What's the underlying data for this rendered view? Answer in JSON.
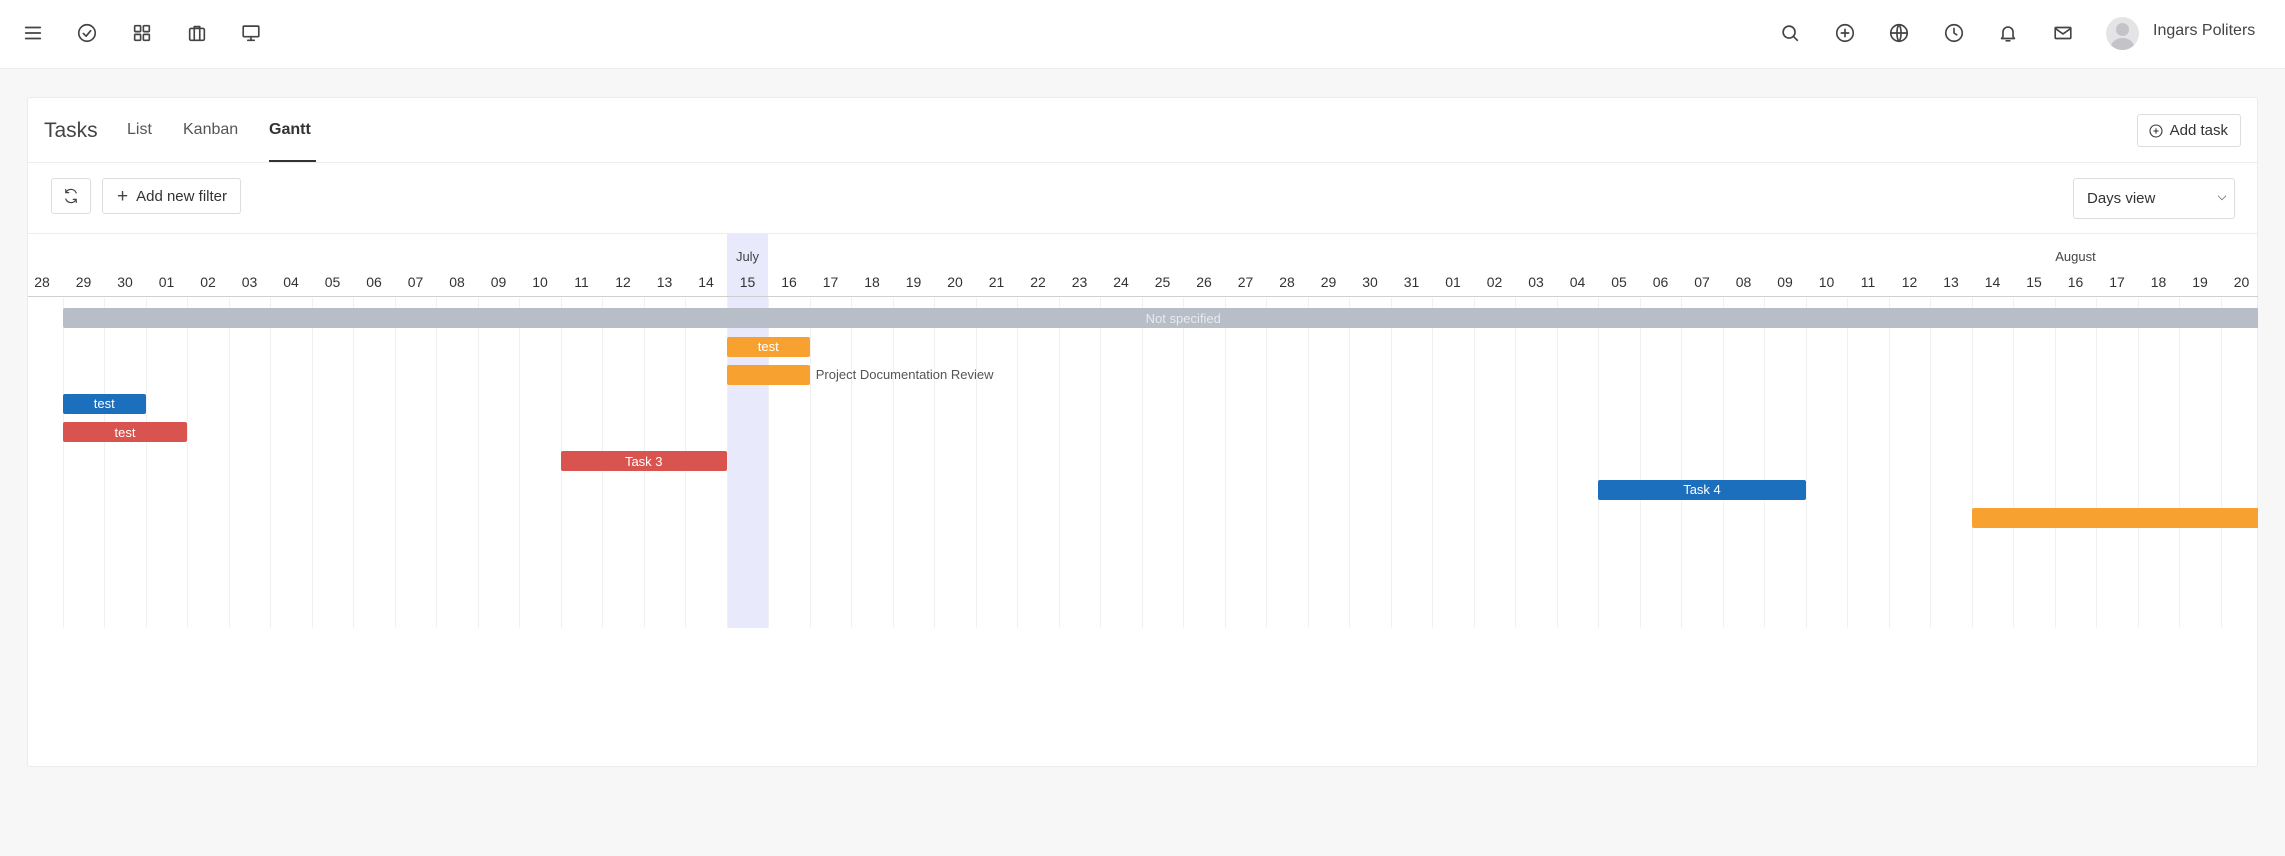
{
  "topbar": {
    "left_icons": [
      "menu-icon",
      "tasks-check-icon",
      "apps-grid-icon",
      "briefcase-icon",
      "monitor-icon"
    ],
    "right_icons": [
      "search-icon",
      "add-circle-icon",
      "globe-icon",
      "clock-icon",
      "bell-icon",
      "mail-icon"
    ],
    "user_name": "Ingars Politers"
  },
  "header": {
    "title": "Tasks",
    "tabs": [
      {
        "label": "List",
        "active": false
      },
      {
        "label": "Kanban",
        "active": false
      },
      {
        "label": "Gantt",
        "active": true
      }
    ],
    "add_task_label": "Add task"
  },
  "toolbar": {
    "add_filter_label": "Add new filter",
    "view_select_value": "Days view"
  },
  "gantt": {
    "months": [
      {
        "label": "July",
        "day_index": 17
      },
      {
        "label": "August",
        "day_index": 49
      }
    ],
    "days": [
      "28",
      "29",
      "30",
      "01",
      "02",
      "03",
      "04",
      "05",
      "06",
      "07",
      "08",
      "09",
      "10",
      "11",
      "12",
      "13",
      "14",
      "15",
      "16",
      "17",
      "18",
      "19",
      "20",
      "21",
      "22",
      "23",
      "24",
      "25",
      "26",
      "27",
      "28",
      "29",
      "30",
      "31",
      "01",
      "02",
      "03",
      "04",
      "05",
      "06",
      "07",
      "08",
      "09",
      "10",
      "11",
      "12",
      "13",
      "14",
      "15",
      "16",
      "17",
      "18",
      "19",
      "20"
    ],
    "today_index": 17,
    "bars": [
      {
        "label": "Not specified",
        "start": 1,
        "span": 54,
        "color": "#b7bec8",
        "row": 0,
        "label_outside": false,
        "text_color": "#e8eaee"
      },
      {
        "label": "test",
        "start": 17,
        "span": 2,
        "color": "#f7a230",
        "row": 1,
        "label_outside": false
      },
      {
        "label": "Project Documentation Review",
        "start": 17,
        "span": 2,
        "color": "#f7a230",
        "row": 2,
        "label_outside": true
      },
      {
        "label": "test",
        "start": 1,
        "span": 2,
        "color": "#1b6fbc",
        "row": 3,
        "label_outside": false
      },
      {
        "label": "test",
        "start": 1,
        "span": 3,
        "color": "#d9534f",
        "row": 4,
        "label_outside": false
      },
      {
        "label": "Task 3",
        "start": 13,
        "span": 4,
        "color": "#d9534f",
        "row": 5,
        "label_outside": false
      },
      {
        "label": "Task 4",
        "start": 38,
        "span": 5,
        "color": "#1b6fbc",
        "row": 6,
        "label_outside": false
      },
      {
        "label": "",
        "start": 47,
        "span": 7,
        "color": "#f7a230",
        "row": 7,
        "label_outside": false
      }
    ]
  }
}
